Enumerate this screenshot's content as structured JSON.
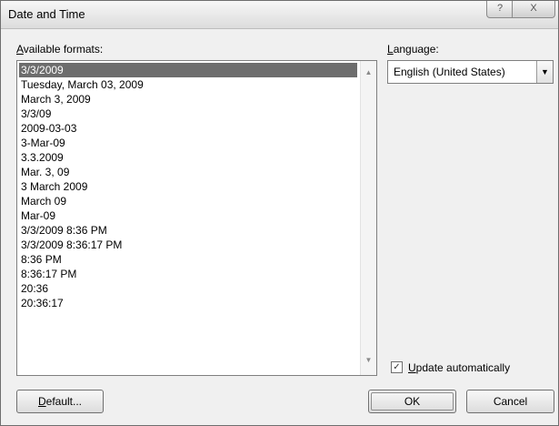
{
  "window": {
    "title": "Date and Time",
    "help_label": "?",
    "close_label": "X"
  },
  "formats": {
    "label": "Available formats:",
    "label_hotkey": "A",
    "label_rest": "vailable formats:",
    "items": [
      "3/3/2009",
      "Tuesday, March 03, 2009",
      "March 3, 2009",
      "3/3/09",
      "2009-03-03",
      "3-Mar-09",
      "3.3.2009",
      "Mar. 3, 09",
      "3 March 2009",
      "March 09",
      "Mar-09",
      "3/3/2009 8:36 PM",
      "3/3/2009 8:36:17 PM",
      "8:36 PM",
      "8:36:17 PM",
      "20:36",
      "20:36:17"
    ],
    "selected_index": 0
  },
  "language": {
    "label": "Language:",
    "label_hotkey": "L",
    "label_rest": "anguage:",
    "value": "English (United States)"
  },
  "update": {
    "label": "Update automatically",
    "label_hotkey": "U",
    "label_rest": "pdate automatically",
    "checked": true
  },
  "buttons": {
    "default_hotkey": "D",
    "default_rest": "efault...",
    "ok": "OK",
    "cancel": "Cancel"
  }
}
